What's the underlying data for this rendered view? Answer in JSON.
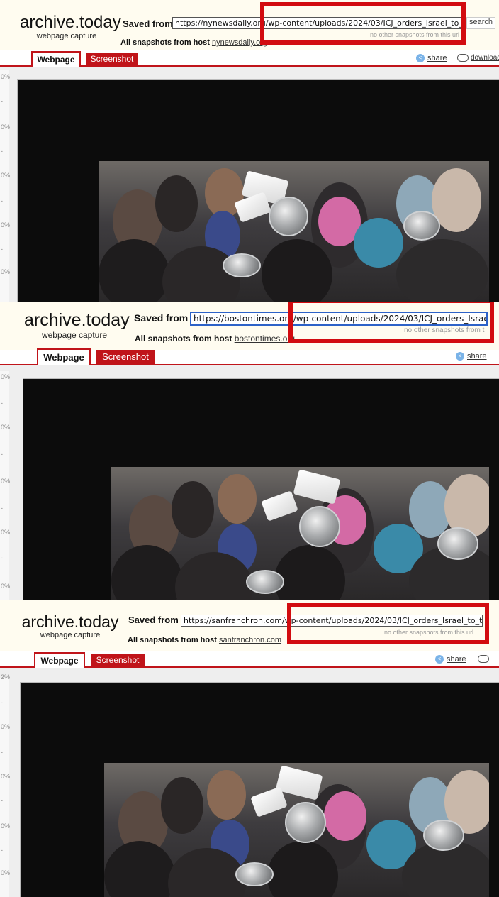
{
  "captures": [
    {
      "logo": "archive.today",
      "logo_sub": "webpage capture",
      "saved_from_label": "Saved from",
      "url": "https://nynewsdaily.org/wp-content/uploads/2024/03/ICJ_orders_Israel_to_take_actio",
      "no_snapshots": "no other snapshots from this url",
      "all_snapshots_label": "All snapshots  from host",
      "host": "nynewsdaily.org",
      "search_label": "search",
      "tab_webpage": "Webpage",
      "tab_screenshot": "Screenshot",
      "share_label": "share",
      "download_label": "download",
      "ruler_ticks": [
        "0%",
        "-",
        "0%",
        "-",
        "0%",
        "-",
        "0%",
        "-",
        "0%"
      ]
    },
    {
      "logo": "archive.today",
      "logo_sub": "webpage capture",
      "saved_from_label": "Saved from",
      "url": "https://bostontimes.org/wp-content/uploads/2024/03/ICJ_orders_Israel_to_take_",
      "no_snapshots": "no other snapshots from t",
      "all_snapshots_label": "All snapshots  from host",
      "host": "bostontimes.org",
      "tab_webpage": "Webpage",
      "tab_screenshot": "Screenshot",
      "share_label": "share",
      "ruler_ticks": [
        "0%",
        "-",
        "0%",
        "-",
        "0%",
        "-",
        "0%",
        "-",
        "0%"
      ]
    },
    {
      "logo": "archive.today",
      "logo_sub": "webpage capture",
      "saved_from_label": "Saved from",
      "url": "https://sanfranchron.com/wp-content/uploads/2024/03/ICJ_orders_Israel_to_take_act",
      "no_snapshots": "no other snapshots from this url",
      "all_snapshots_label": "All snapshots  from host",
      "host": "sanfranchron.com",
      "tab_webpage": "Webpage",
      "tab_screenshot": "Screenshot",
      "share_label": "share",
      "ruler_ticks": [
        "2%",
        "-",
        "0%",
        "-",
        "0%",
        "-",
        "0%",
        "-",
        "0%"
      ]
    }
  ],
  "colors": {
    "accent_red": "#c0141a",
    "highlight_box": "#d20c10",
    "header_bg": "#fffcf0"
  }
}
